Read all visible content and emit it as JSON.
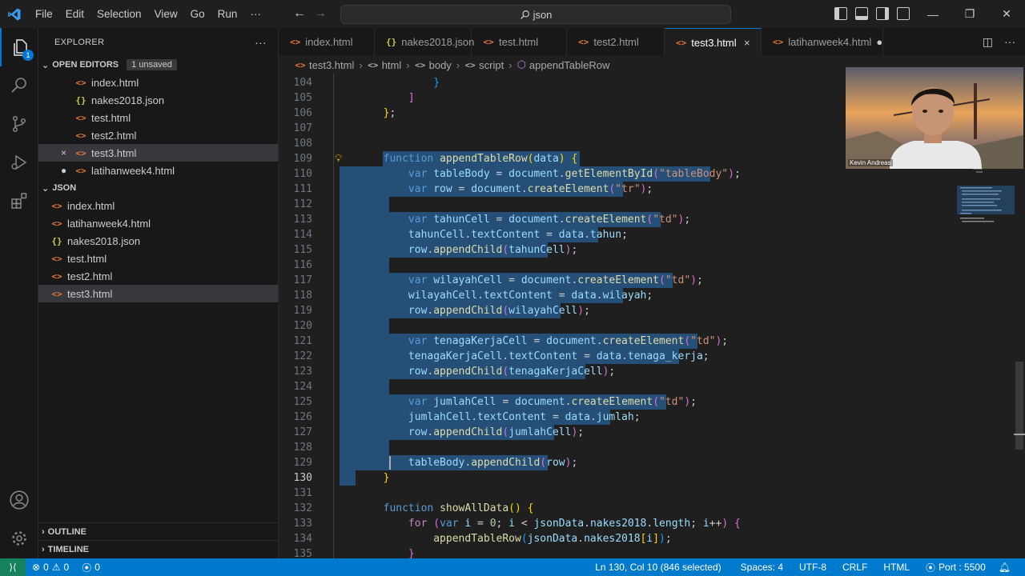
{
  "menu": [
    "File",
    "Edit",
    "Selection",
    "View",
    "Go",
    "Run",
    "···"
  ],
  "search": {
    "text": "json"
  },
  "sidebar": {
    "title": "EXPLORER",
    "open_editors": {
      "label": "OPEN EDITORS",
      "badge": "1 unsaved",
      "items": [
        {
          "name": "index.html",
          "icon": "html-file-icon",
          "mark": ""
        },
        {
          "name": "nakes2018.json",
          "icon": "json-file-icon",
          "mark": ""
        },
        {
          "name": "test.html",
          "icon": "html-file-icon",
          "mark": ""
        },
        {
          "name": "test2.html",
          "icon": "html-file-icon",
          "mark": ""
        },
        {
          "name": "test3.html",
          "icon": "html-file-icon",
          "mark": "×"
        },
        {
          "name": "latihanweek4.html",
          "icon": "html-file-icon",
          "mark": "●"
        }
      ]
    },
    "folder": {
      "label": "JSON",
      "items": [
        {
          "name": "index.html",
          "icon": "html-file-icon"
        },
        {
          "name": "latihanweek4.html",
          "icon": "html-file-icon"
        },
        {
          "name": "nakes2018.json",
          "icon": "json-file-icon"
        },
        {
          "name": "test.html",
          "icon": "html-file-icon"
        },
        {
          "name": "test2.html",
          "icon": "html-file-icon"
        },
        {
          "name": "test3.html",
          "icon": "html-file-icon"
        }
      ]
    },
    "outline": "OUTLINE",
    "timeline": "TIMELINE"
  },
  "activity_badge": "1",
  "tabs": [
    {
      "label": "index.html",
      "icon": "html-file-icon",
      "close": "",
      "active": false
    },
    {
      "label": "nakes2018.json",
      "icon": "json-file-icon",
      "close": "",
      "active": false
    },
    {
      "label": "test.html",
      "icon": "html-file-icon",
      "close": "",
      "active": false
    },
    {
      "label": "test2.html",
      "icon": "html-file-icon",
      "close": "",
      "active": false
    },
    {
      "label": "test3.html",
      "icon": "html-file-icon",
      "close": "×",
      "active": true
    },
    {
      "label": "latihanweek4.html",
      "icon": "html-file-icon",
      "close": "●",
      "active": false
    }
  ],
  "breadcrumb": [
    "test3.html",
    "html",
    "body",
    "script",
    "appendTableRow"
  ],
  "editor": {
    "current_line": 130,
    "lines": [
      {
        "n": "104",
        "html": "<span class='p'>                </span><span class='b3'>}</span>"
      },
      {
        "n": "105",
        "html": "<span class='p'>            </span><span class='b2'>]</span>"
      },
      {
        "n": "106",
        "html": "<span class='p'>        </span><span class='b1'>}</span><span class='p'>;</span>"
      },
      {
        "n": "107",
        "html": ""
      },
      {
        "n": "108",
        "html": ""
      },
      {
        "n": "109",
        "html": "<span class='p'>        </span><span class='k'>function</span> <span class='f'>appendTableRow</span><span class='b1'>(</span><span class='v'>data</span><span class='b1'>)</span> <span class='b1'>{</span>"
      },
      {
        "n": "110",
        "html": "<span class='p'>            </span><span class='k'>var</span> <span class='v'>tableBody</span> <span class='p'>=</span> <span class='v'>document</span><span class='p'>.</span><span class='f'>getElementById</span><span class='b2'>(</span><span class='s'>\"tableBody\"</span><span class='b2'>)</span><span class='p'>;</span>"
      },
      {
        "n": "111",
        "html": "<span class='p'>            </span><span class='k'>var</span> <span class='v'>row</span> <span class='p'>=</span> <span class='v'>document</span><span class='p'>.</span><span class='f'>createElement</span><span class='b2'>(</span><span class='s'>\"tr\"</span><span class='b2'>)</span><span class='p'>;</span>"
      },
      {
        "n": "112",
        "html": ""
      },
      {
        "n": "113",
        "html": "<span class='p'>            </span><span class='k'>var</span> <span class='v'>tahunCell</span> <span class='p'>=</span> <span class='v'>document</span><span class='p'>.</span><span class='f'>createElement</span><span class='b2'>(</span><span class='s'>\"td\"</span><span class='b2'>)</span><span class='p'>;</span>"
      },
      {
        "n": "114",
        "html": "<span class='p'>            </span><span class='v'>tahunCell</span><span class='p'>.</span><span class='v'>textContent</span> <span class='p'>=</span> <span class='v'>data</span><span class='p'>.</span><span class='v'>tahun</span><span class='p'>;</span>"
      },
      {
        "n": "115",
        "html": "<span class='p'>            </span><span class='v'>row</span><span class='p'>.</span><span class='f'>appendChild</span><span class='b2'>(</span><span class='v'>tahunCell</span><span class='b2'>)</span><span class='p'>;</span>"
      },
      {
        "n": "116",
        "html": ""
      },
      {
        "n": "117",
        "html": "<span class='p'>            </span><span class='k'>var</span> <span class='v'>wilayahCell</span> <span class='p'>=</span> <span class='v'>document</span><span class='p'>.</span><span class='f'>createElement</span><span class='b2'>(</span><span class='s'>\"td\"</span><span class='b2'>)</span><span class='p'>;</span>"
      },
      {
        "n": "118",
        "html": "<span class='p'>            </span><span class='v'>wilayahCell</span><span class='p'>.</span><span class='v'>textContent</span> <span class='p'>=</span> <span class='v'>data</span><span class='p'>.</span><span class='v'>wilayah</span><span class='p'>;</span>"
      },
      {
        "n": "119",
        "html": "<span class='p'>            </span><span class='v'>row</span><span class='p'>.</span><span class='f'>appendChild</span><span class='b2'>(</span><span class='v'>wilayahCell</span><span class='b2'>)</span><span class='p'>;</span>"
      },
      {
        "n": "120",
        "html": ""
      },
      {
        "n": "121",
        "html": "<span class='p'>            </span><span class='k'>var</span> <span class='v'>tenagaKerjaCell</span> <span class='p'>=</span> <span class='v'>document</span><span class='p'>.</span><span class='f'>createElement</span><span class='b2'>(</span><span class='s'>\"td\"</span><span class='b2'>)</span><span class='p'>;</span>"
      },
      {
        "n": "122",
        "html": "<span class='p'>            </span><span class='v'>tenagaKerjaCell</span><span class='p'>.</span><span class='v'>textContent</span> <span class='p'>=</span> <span class='v'>data</span><span class='p'>.</span><span class='v'>tenaga_kerja</span><span class='p'>;</span>"
      },
      {
        "n": "123",
        "html": "<span class='p'>            </span><span class='v'>row</span><span class='p'>.</span><span class='f'>appendChild</span><span class='b2'>(</span><span class='v'>tenagaKerjaCell</span><span class='b2'>)</span><span class='p'>;</span>"
      },
      {
        "n": "124",
        "html": ""
      },
      {
        "n": "125",
        "html": "<span class='p'>            </span><span class='k'>var</span> <span class='v'>jumlahCell</span> <span class='p'>=</span> <span class='v'>document</span><span class='p'>.</span><span class='f'>createElement</span><span class='b2'>(</span><span class='s'>\"td\"</span><span class='b2'>)</span><span class='p'>;</span>"
      },
      {
        "n": "126",
        "html": "<span class='p'>            </span><span class='v'>jumlahCell</span><span class='p'>.</span><span class='v'>textContent</span> <span class='p'>=</span> <span class='v'>data</span><span class='p'>.</span><span class='v'>jumlah</span><span class='p'>;</span>"
      },
      {
        "n": "127",
        "html": "<span class='p'>            </span><span class='v'>row</span><span class='p'>.</span><span class='f'>appendChild</span><span class='b2'>(</span><span class='v'>jumlahCell</span><span class='b2'>)</span><span class='p'>;</span>"
      },
      {
        "n": "128",
        "html": ""
      },
      {
        "n": "129",
        "html": "<span class='p'>            </span><span class='v'>tableBody</span><span class='p'>.</span><span class='f'>appendChild</span><span class='b2'>(</span><span class='v'>row</span><span class='b2'>)</span><span class='p'>;</span>"
      },
      {
        "n": "130",
        "html": "<span class='p'>        </span><span class='b1'>}</span>"
      },
      {
        "n": "131",
        "html": ""
      },
      {
        "n": "132",
        "html": "<span class='p'>        </span><span class='k'>function</span> <span class='f'>showAllData</span><span class='b1'>()</span> <span class='b1'>{</span>"
      },
      {
        "n": "133",
        "html": "<span class='p'>            </span><span class='c'>for</span> <span class='b2'>(</span><span class='k'>var</span> <span class='v'>i</span> <span class='p'>=</span> <span class='n'>0</span><span class='p'>;</span> <span class='v'>i</span> <span class='p'>&lt;</span> <span class='v'>jsonData</span><span class='p'>.</span><span class='v'>nakes2018</span><span class='p'>.</span><span class='v'>length</span><span class='p'>;</span> <span class='v'>i</span><span class='p'>++</span><span class='b2'>)</span> <span class='b2'>{</span>"
      },
      {
        "n": "134",
        "html": "<span class='p'>                </span><span class='f'>appendTableRow</span><span class='b3'>(</span><span class='v'>jsonData</span><span class='p'>.</span><span class='v'>nakes2018</span><span class='b1'>[</span><span class='v'>i</span><span class='b1'>]</span><span class='b3'>)</span><span class='p'>;</span>"
      },
      {
        "n": "135",
        "html": "<span class='p'>            </span><span class='b2'>}</span>"
      }
    ]
  },
  "webcam": {
    "name": "Kevin Andreas"
  },
  "status": {
    "problems_errors": "0",
    "problems_warnings": "0",
    "ports": "0",
    "position": "Ln 130, Col 10 (846 selected)",
    "spaces": "Spaces: 4",
    "encoding": "UTF-8",
    "eol": "CRLF",
    "language": "HTML",
    "port": "Port : 5500"
  },
  "colors": {
    "accent": "#007acc",
    "selection": "#264f78",
    "html_icon": "#e37933",
    "json_icon": "#cbcb41"
  }
}
